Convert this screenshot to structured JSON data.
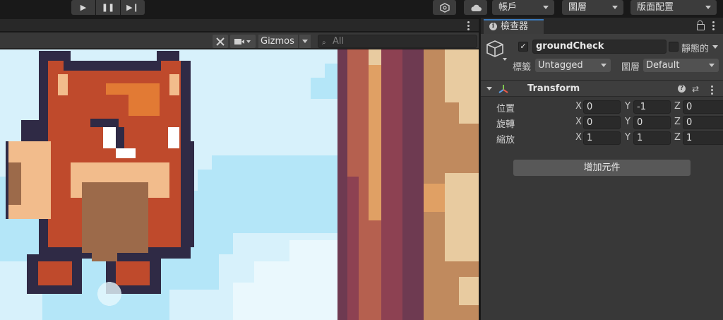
{
  "toolbar": {
    "account_label": "帳戶",
    "layers_label": "圖層",
    "layout_label": "版面配置",
    "icons": [
      "play-icon",
      "pause-icon",
      "step-icon",
      "collab-icon",
      "cloud-icon"
    ]
  },
  "scene": {
    "gizmos_label": "Gizmos",
    "search_placeholder": "All",
    "icons": [
      "tools-icon",
      "camera-icon"
    ]
  },
  "inspector": {
    "tab_label": "檢查器",
    "object_name": "groundCheck",
    "static_label": "靜態的",
    "tag_label": "標籤",
    "tag_value": "Untagged",
    "layer_label": "圖層",
    "layer_value": "Default",
    "active": true,
    "transform": {
      "title": "Transform",
      "rows": [
        {
          "label": "位置",
          "x": "0",
          "y": "-1",
          "z": "0"
        },
        {
          "label": "旋轉",
          "x": "0",
          "y": "0",
          "z": "0"
        },
        {
          "label": "縮放",
          "x": "1",
          "y": "1",
          "z": "1"
        }
      ],
      "axis_labels": [
        "X",
        "Y",
        "Z"
      ]
    },
    "add_component_label": "增加元件"
  },
  "colors": {
    "accent_blue": "#3a79bb",
    "sky": "#d7f1fb",
    "fox_red": "#bf4a2c",
    "fox_orange": "#e27a34",
    "fox_tan": "#f2bc8c",
    "outline": "#2f2a45",
    "wood_dark": "#6e3a51",
    "wood_mid": "#b5604f",
    "wood_light": "#e0a064"
  }
}
